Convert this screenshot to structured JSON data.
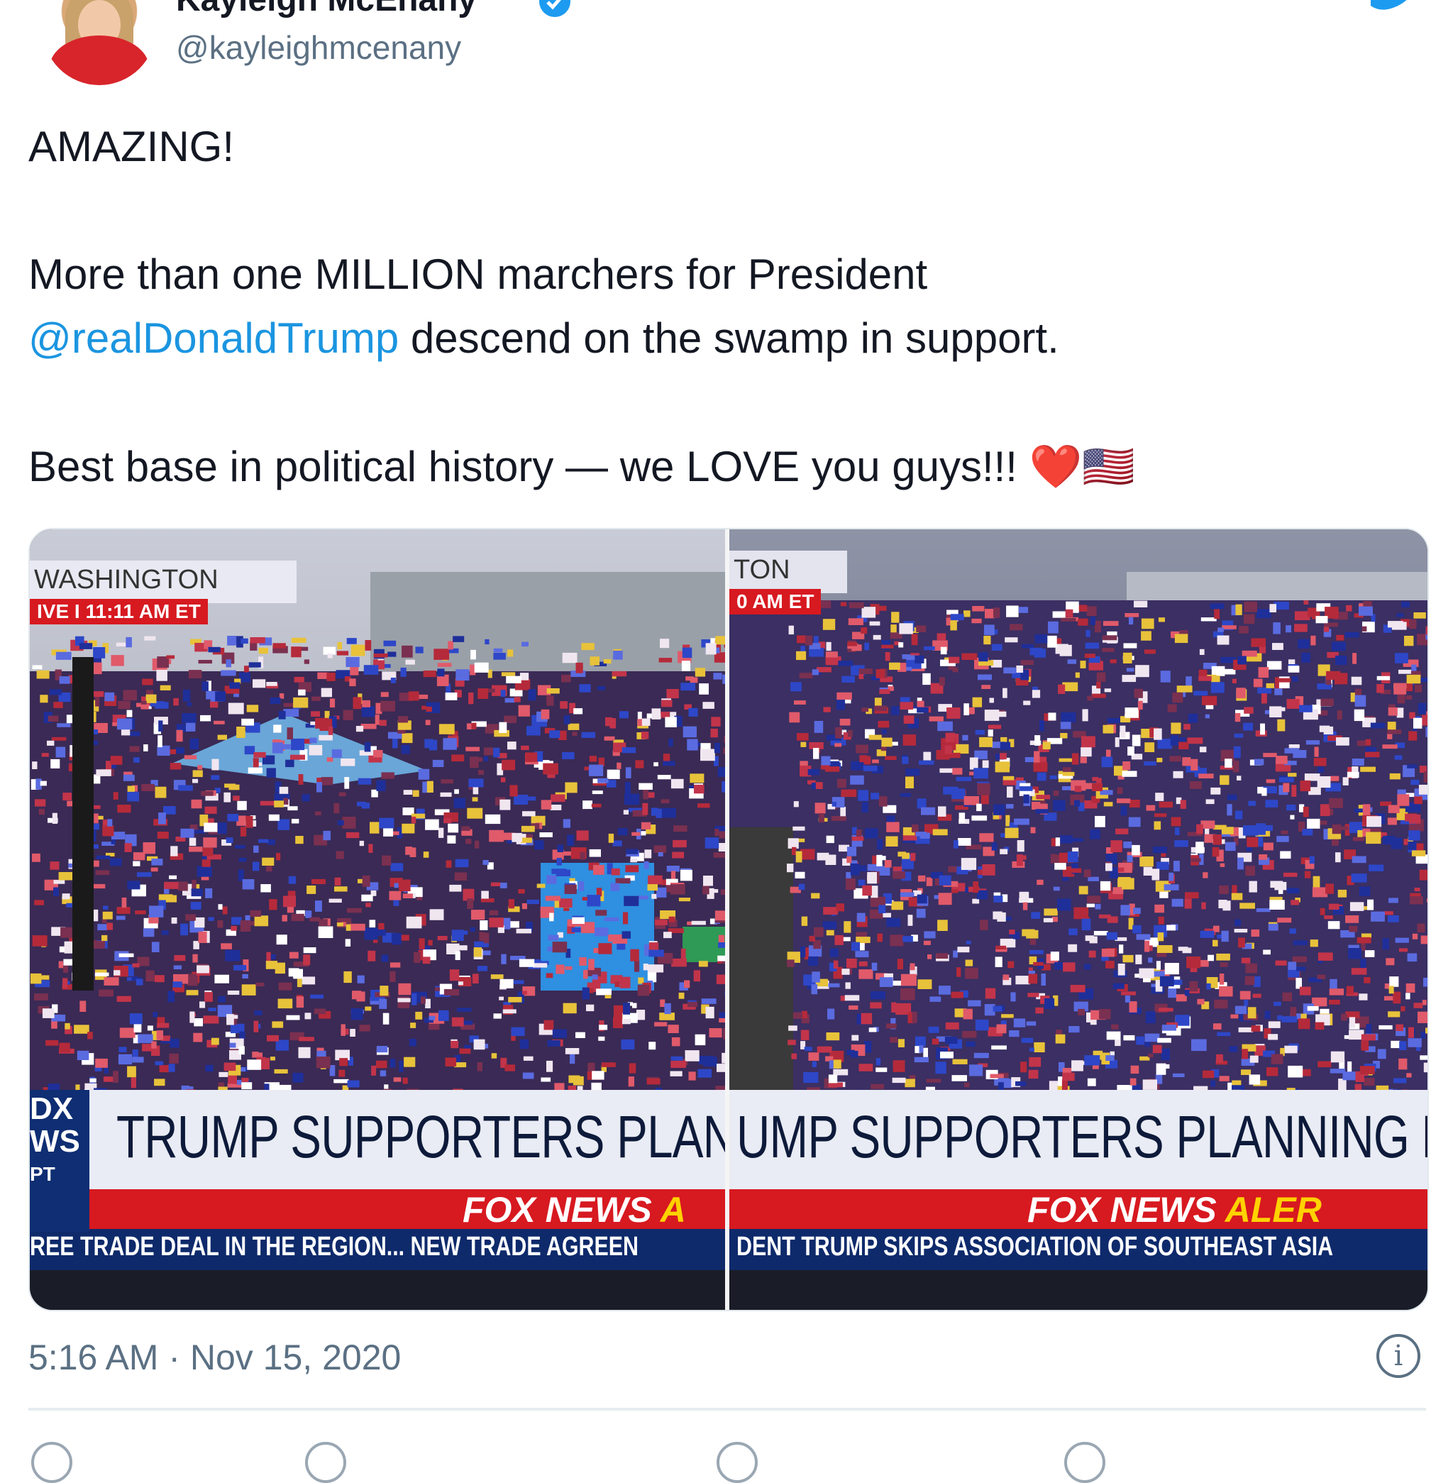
{
  "header": {
    "display_name": "Kayleigh McEnany",
    "handle": "@kayleighmcenany"
  },
  "tweet": {
    "line1": "AMAZING!",
    "line2": "More than one MILLION marchers for President",
    "mention": "@realDonaldTrump",
    "line3_rest": " descend on the swamp in support.",
    "line4": "Best base in political history — we LOVE you guys!!!",
    "heart": "❤️",
    "flag": "🇺🇸"
  },
  "media": {
    "left": {
      "location": "WASHINGTON",
      "live": "IVE  I  11:11 AM ET",
      "headline": "TRUMP SUPPORTERS PLANNINC",
      "alert": "FOX NEWS ",
      "alert_tail": "A",
      "ticker": "REE TRADE DEAL IN THE REGION...   NEW TRADE AGREEN",
      "logo_lines": [
        "DX",
        "WS",
        "PT"
      ]
    },
    "right": {
      "location": "TON",
      "live": "0 AM ET",
      "headline": "UMP SUPPORTERS PLANNING DC M",
      "alert": "FOX NEWS ",
      "alert_tail": "ALER",
      "ticker": "DENT TRUMP SKIPS ASSOCIATION OF SOUTHEAST ASIA"
    }
  },
  "footer": {
    "timestamp": "5:16 AM · Nov 15, 2020",
    "info": "i"
  },
  "colors": {
    "mention": "#1b95e0",
    "fox_red": "#d71920",
    "fox_navy": "#0e2a6b",
    "alert_yellow": "#ffd200"
  },
  "icons": [
    "verified-badge-icon",
    "twitter-bird-icon",
    "info-icon",
    "reply-icon",
    "retweet-icon",
    "like-icon",
    "share-icon"
  ]
}
